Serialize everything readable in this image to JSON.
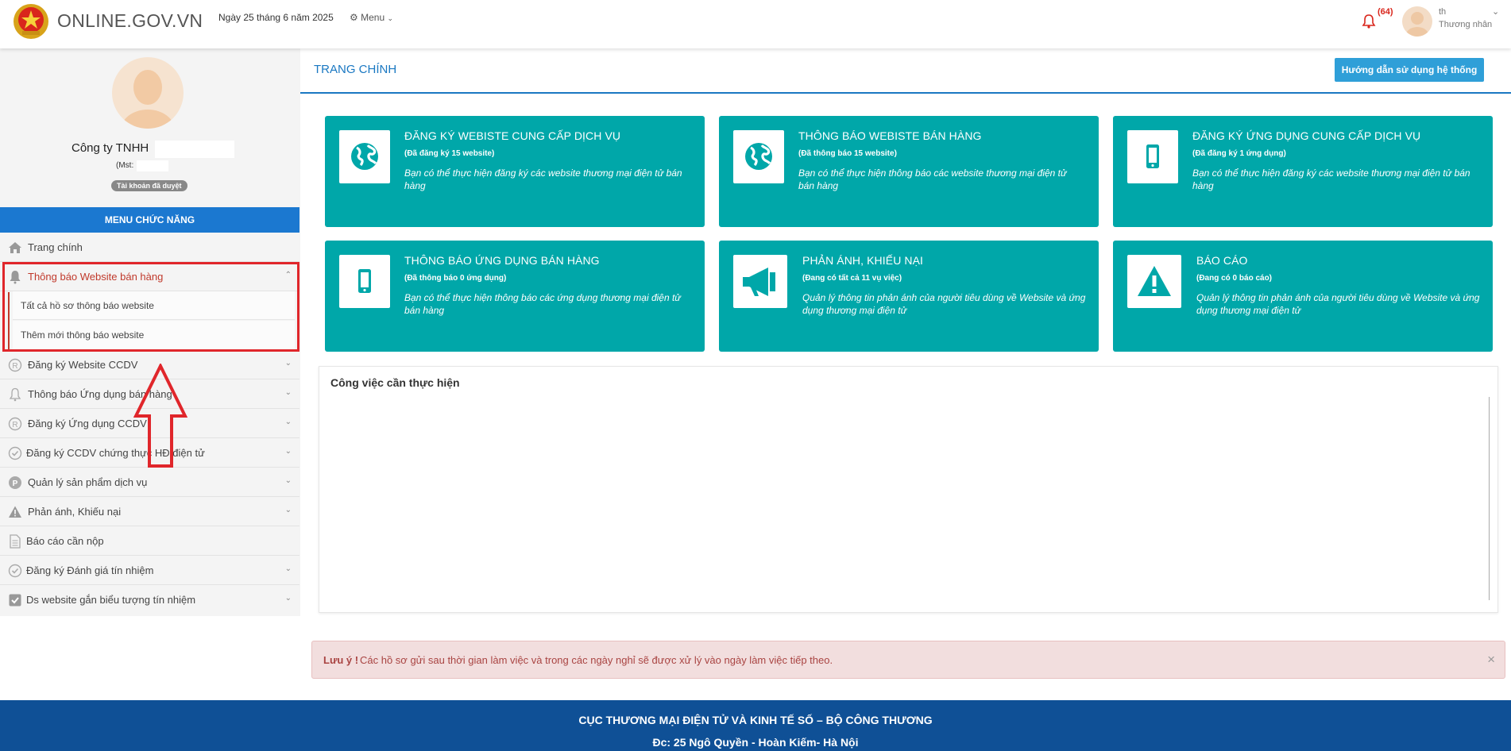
{
  "header": {
    "brand": "ONLINE.GOV.VN",
    "date": "Ngày 25 tháng 6 năm 2025",
    "menu_label": "Menu",
    "notification_count": "(64)",
    "user_name": "th",
    "user_role": "Thương nhân",
    "accent_color": "#d9261c"
  },
  "sidebar": {
    "company": "Công ty TNHH",
    "mst": "(Mst:",
    "status_badge": "Tài khoản đã duyệt",
    "menu_header": "MENU CHỨC NĂNG",
    "items": [
      {
        "label": "Trang chính",
        "icon": "home-icon"
      },
      {
        "label": "Thông báo Website bán hàng",
        "icon": "bell-icon",
        "active": true
      },
      {
        "label": "Đăng ký Website CCDV",
        "icon": "registered-icon"
      },
      {
        "label": "Thông báo Ứng dụng bán hàng",
        "icon": "bell-outline-icon"
      },
      {
        "label": "Đăng ký Ứng dụng CCDV",
        "icon": "registered-icon"
      },
      {
        "label": "Đăng ký CCDV chứng thực HĐ điện tử",
        "icon": "check-circle-icon"
      },
      {
        "label": "Quản lý sản phẩm dịch vụ",
        "icon": "p-circle-icon"
      },
      {
        "label": "Phản ánh, Khiếu nại",
        "icon": "warning-icon"
      },
      {
        "label": "Báo cáo cần nộp",
        "icon": "document-icon"
      },
      {
        "label": "Đăng ký Đánh giá tín nhiệm",
        "icon": "check-circle-icon"
      },
      {
        "label": "Ds website gắn biểu tượng tín nhiệm",
        "icon": "checkbox-icon"
      }
    ],
    "sub_items": [
      {
        "label": "Tất cả hồ sơ thông báo website"
      },
      {
        "label": "Thêm mới thông báo website"
      }
    ]
  },
  "main": {
    "page_title": "TRANG CHÍNH",
    "guide_button": "Hướng dẫn sử dụng hệ thống",
    "cards": [
      {
        "title": "ĐĂNG KÝ WEBISTE CUNG CẤP DỊCH VỤ",
        "sub": "(Đã đăng ký 15 website)",
        "desc": "Bạn có thể thực hiện đăng ký các website thương mại điện tử bán hàng",
        "icon": "globe-icon"
      },
      {
        "title": "THÔNG BÁO WEBISTE BÁN HÀNG",
        "sub": "(Đã thông báo 15 website)",
        "desc": "Bạn có thể thực hiện thông báo các website thương mại điện tử bán hàng",
        "icon": "globe-icon"
      },
      {
        "title": "ĐĂNG KÝ ỨNG DỤNG CUNG CẤP DỊCH VỤ",
        "sub": "(Đã đăng ký 1 ứng dụng)",
        "desc": "Bạn có thể thực hiện đăng ký các website thương mại điện tử bán hàng",
        "icon": "mobile-icon"
      },
      {
        "title": "THÔNG BÁO ỨNG DỤNG BÁN HÀNG",
        "sub": "(Đã thông báo 0 ứng dụng)",
        "desc": "Bạn có thể thực hiện thông báo các ứng dụng thương mại điện tử bán hàng",
        "icon": "mobile-icon"
      },
      {
        "title": "PHẢN ÁNH, KHIẾU NẠI",
        "sub": "(Đang có tất cả 11 vụ việc)",
        "desc": "Quản lý thông tin phản ánh của người tiêu dùng về Website và ứng dụng thương mại điện tử",
        "icon": "megaphone-icon"
      },
      {
        "title": "BÁO CÁO",
        "sub": "(Đang có 0 báo cáo)",
        "desc": "Quản lý thông tin phản ánh của người tiêu dùng về Website và ứng dụng thương mại điện tử",
        "icon": "warning-icon"
      }
    ],
    "tasks_title": "Công việc cần thực hiện",
    "alert_strong": "Lưu ý !",
    "alert_text": "Các hồ sơ gửi sau thời gian làm việc và trong các ngày nghỉ sẽ được xử lý vào ngày làm việc tiếp theo.",
    "alert_close": "×",
    "card_color": "#00a7a9"
  },
  "footer": {
    "line1": "CỤC THƯƠNG MẠI ĐIỆN TỬ VÀ KINH TẾ SỐ – BỘ CÔNG THƯƠNG",
    "line2": "Đc: 25 Ngô Quyền - Hoàn Kiếm- Hà Nội"
  }
}
